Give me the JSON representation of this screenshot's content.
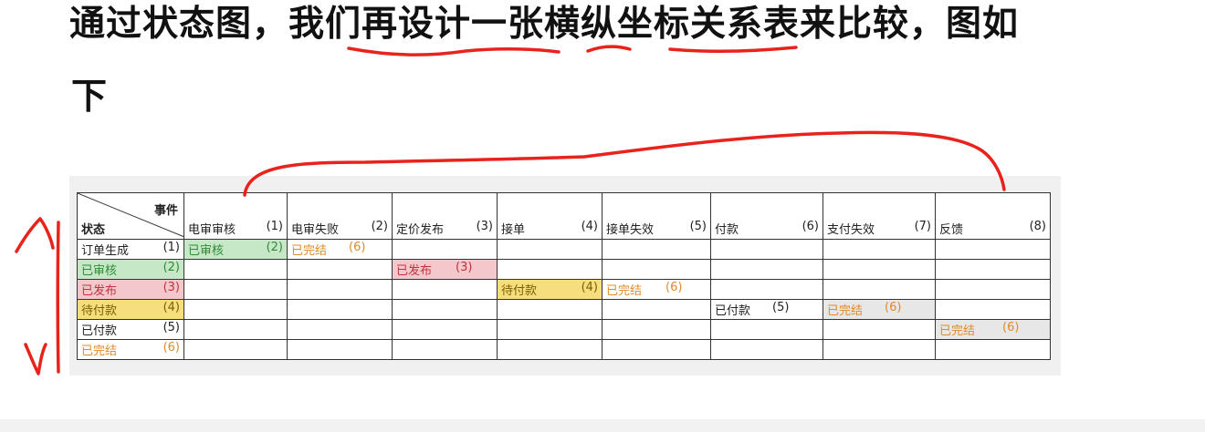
{
  "heading": {
    "line1": "通过状态图，我们再设计一张横纵坐标关系表来比较，图如",
    "line2": "下"
  },
  "matrix": {
    "corner_event": "事件",
    "corner_state": "状态",
    "events": [
      {
        "label": "电审审核",
        "num": "(1)"
      },
      {
        "label": "电审失败",
        "num": "(2)"
      },
      {
        "label": "定价发布",
        "num": "(3)"
      },
      {
        "label": "接单",
        "num": "(4)"
      },
      {
        "label": "接单失效",
        "num": "(5)"
      },
      {
        "label": "付款",
        "num": "(6)"
      },
      {
        "label": "支付失效",
        "num": "(7)"
      },
      {
        "label": "反馈",
        "num": "(8)"
      }
    ],
    "states": [
      {
        "label": "订单生成",
        "num": "(1)"
      },
      {
        "label": "已审核",
        "num": "(2)"
      },
      {
        "label": "已发布",
        "num": "(3)"
      },
      {
        "label": "待付款",
        "num": "(4)"
      },
      {
        "label": "已付款",
        "num": "(5)"
      },
      {
        "label": "已完结",
        "num": "(6)"
      }
    ],
    "transitions": {
      "r0c0": {
        "label": "已审核",
        "num": "(2)"
      },
      "r0c1": {
        "label": "已完结",
        "num": "(6)"
      },
      "r1c2": {
        "label": "已发布",
        "num": "(3)"
      },
      "r2c3": {
        "label": "待付款",
        "num": "(4)"
      },
      "r2c4": {
        "label": "已完结",
        "num": "(6)"
      },
      "r3c5": {
        "label": "已付款",
        "num": "(5)"
      },
      "r3c6": {
        "label": "已完结",
        "num": "(6)"
      },
      "r4c7": {
        "label": "已完结",
        "num": "(6)"
      }
    }
  },
  "colors": {
    "annotation": "#e8231c",
    "green_fill": "#c6e8c6",
    "pink_fill": "#f3c7cc",
    "yellow_fill": "#f6dd7e",
    "orange_text": "#e08a2a"
  }
}
